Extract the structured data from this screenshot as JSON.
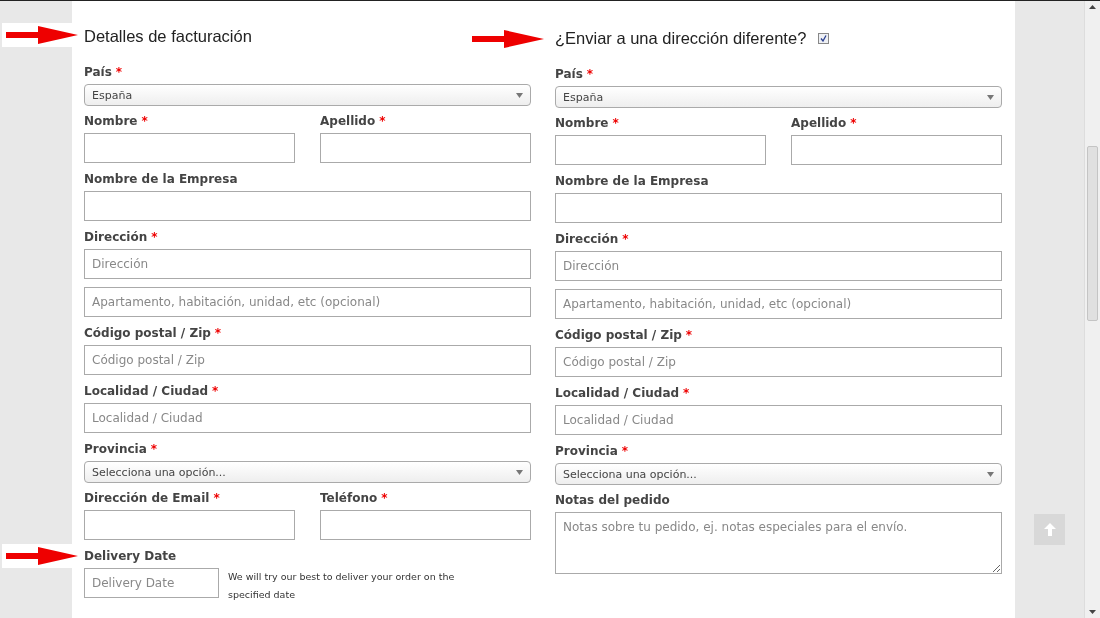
{
  "billing": {
    "title": "Detalles de facturación",
    "rows": [
      {
        "kind": "select",
        "label": "País",
        "mark": "*",
        "value": "España"
      },
      {
        "kind": "pair",
        "items": [
          {
            "label": "Nombre",
            "mark": "*"
          },
          {
            "label": "Apellido",
            "mark": "*"
          }
        ]
      },
      {
        "kind": "text",
        "label": "Nombre de la Empresa"
      },
      {
        "kind": "text",
        "label": "Dirección",
        "mark": "*",
        "placeholders": [
          "Dirección",
          "Apartamento, habitación, unidad, etc (opcional)"
        ]
      },
      {
        "kind": "text",
        "label": "Código postal / Zip",
        "mark": "*",
        "placeholders": [
          "Código postal / Zip"
        ]
      },
      {
        "kind": "text",
        "label": "Localidad / Ciudad",
        "mark": "*",
        "placeholders": [
          "Localidad / Ciudad"
        ]
      },
      {
        "kind": "select",
        "label": "Provincia",
        "mark": "*",
        "value": "Selecciona una opción..."
      },
      {
        "kind": "pair",
        "items": [
          {
            "label": "Dirección de Email",
            "mark": "*"
          },
          {
            "label": "Teléfono",
            "mark": "*"
          }
        ]
      },
      {
        "kind": "date",
        "label": "Delivery Date",
        "placeholder": "Delivery Date",
        "note": "We will try our best to deliver your order on the specified date"
      }
    ]
  },
  "shipping": {
    "title": "¿Enviar a una dirección diferente?",
    "checked": true,
    "rows": [
      {
        "kind": "select",
        "label": "País",
        "mark": "*",
        "value": "España"
      },
      {
        "kind": "pair",
        "items": [
          {
            "label": "Nombre",
            "mark": "*"
          },
          {
            "label": "Apellido",
            "mark": "*"
          }
        ]
      },
      {
        "kind": "text",
        "label": "Nombre de la Empresa"
      },
      {
        "kind": "text",
        "label": "Dirección",
        "mark": "*",
        "placeholders": [
          "Dirección",
          "Apartamento, habitación, unidad, etc (opcional)"
        ]
      },
      {
        "kind": "text",
        "label": "Código postal / Zip",
        "mark": "*",
        "placeholders": [
          "Código postal / Zip"
        ]
      },
      {
        "kind": "text",
        "label": "Localidad / Ciudad",
        "mark": "*",
        "placeholders": [
          "Localidad / Ciudad"
        ]
      },
      {
        "kind": "select",
        "label": "Provincia",
        "mark": "*",
        "value": "Selecciona una opción..."
      },
      {
        "kind": "textarea",
        "label": "Notas del pedido",
        "placeholder": "Notas sobre tu pedido, ej. notas especiales para el envío."
      }
    ]
  }
}
